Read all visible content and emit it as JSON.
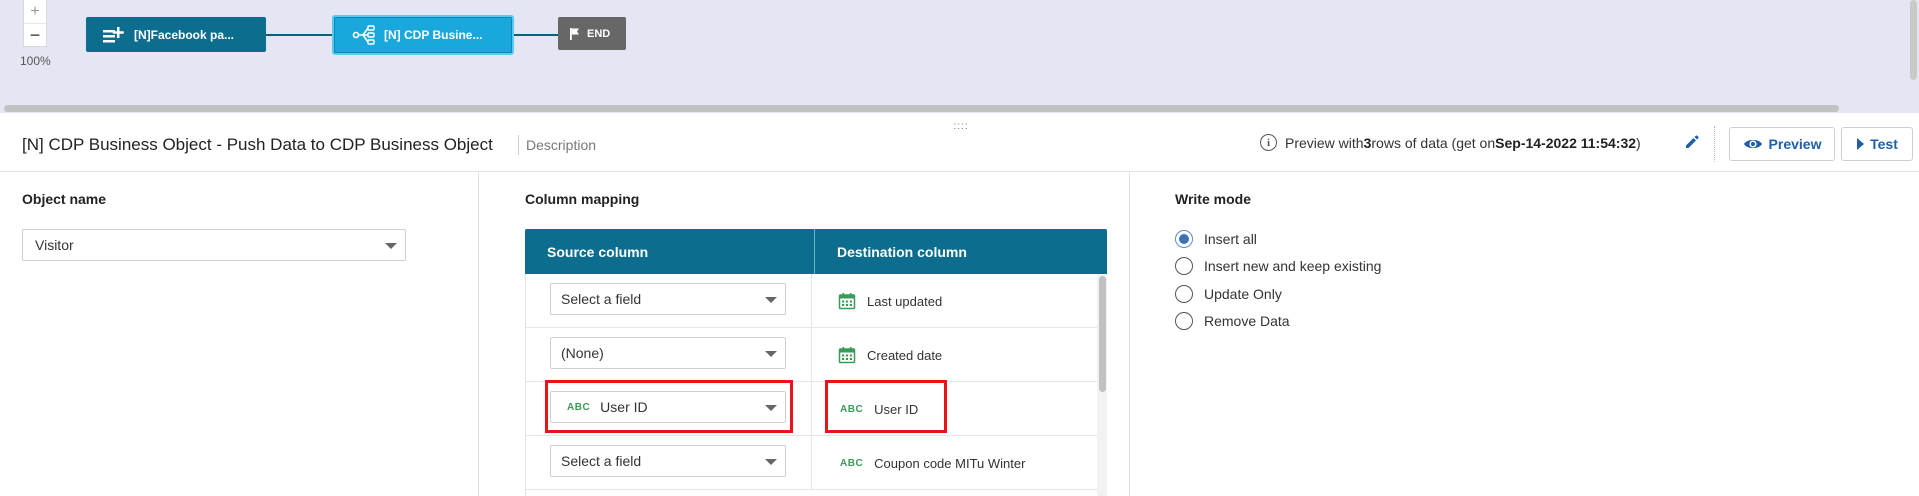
{
  "canvas": {
    "zoom_in_label": "+",
    "zoom_out_label": "−",
    "zoom_level": "100%",
    "nodes": {
      "facebook": "[N]Facebook pa...",
      "cdp": "[N] CDP Busine...",
      "end": "END"
    },
    "drag_handle": "::::"
  },
  "header": {
    "title": "[N] CDP Business Object - Push Data to CDP Business Object",
    "description": "Description",
    "preview_prefix": "Preview with ",
    "preview_rows": "3",
    "preview_mid": " rows of data (get on ",
    "preview_date": "Sep-14-2022 11:54:32",
    "preview_suffix": ")",
    "preview_button": "Preview",
    "test_button": "Test"
  },
  "object_panel": {
    "label": "Object name",
    "value": "Visitor"
  },
  "mapping_panel": {
    "label": "Column mapping",
    "source_header": "Source column",
    "destination_header": "Destination column",
    "rows": [
      {
        "source": "Select a field",
        "source_type": "",
        "destination": "Last updated",
        "destination_icon": "calendar-icon"
      },
      {
        "source": "(None)",
        "source_type": "",
        "destination": "Created date",
        "destination_icon": "calendar-icon"
      },
      {
        "source": "User ID",
        "source_type": "ABC",
        "destination": "User ID",
        "destination_type": "ABC",
        "destination_icon": "abc-text-icon"
      },
      {
        "source": "Select a field",
        "source_type": "",
        "destination": "Coupon code MITu Winter",
        "destination_type": "ABC",
        "destination_icon": "abc-text-icon"
      }
    ]
  },
  "write_mode": {
    "label": "Write mode",
    "options": [
      "Insert all",
      "Insert new and keep existing",
      "Update Only",
      "Remove Data"
    ],
    "selected": "Insert all"
  },
  "colors": {
    "primary": "#0d6d8e",
    "accent": "#1aa8dc",
    "link": "#1e5fa8",
    "highlight": "#e8141b",
    "canvas_bg": "#e4e6f3",
    "type_green": "#3a9a57"
  }
}
